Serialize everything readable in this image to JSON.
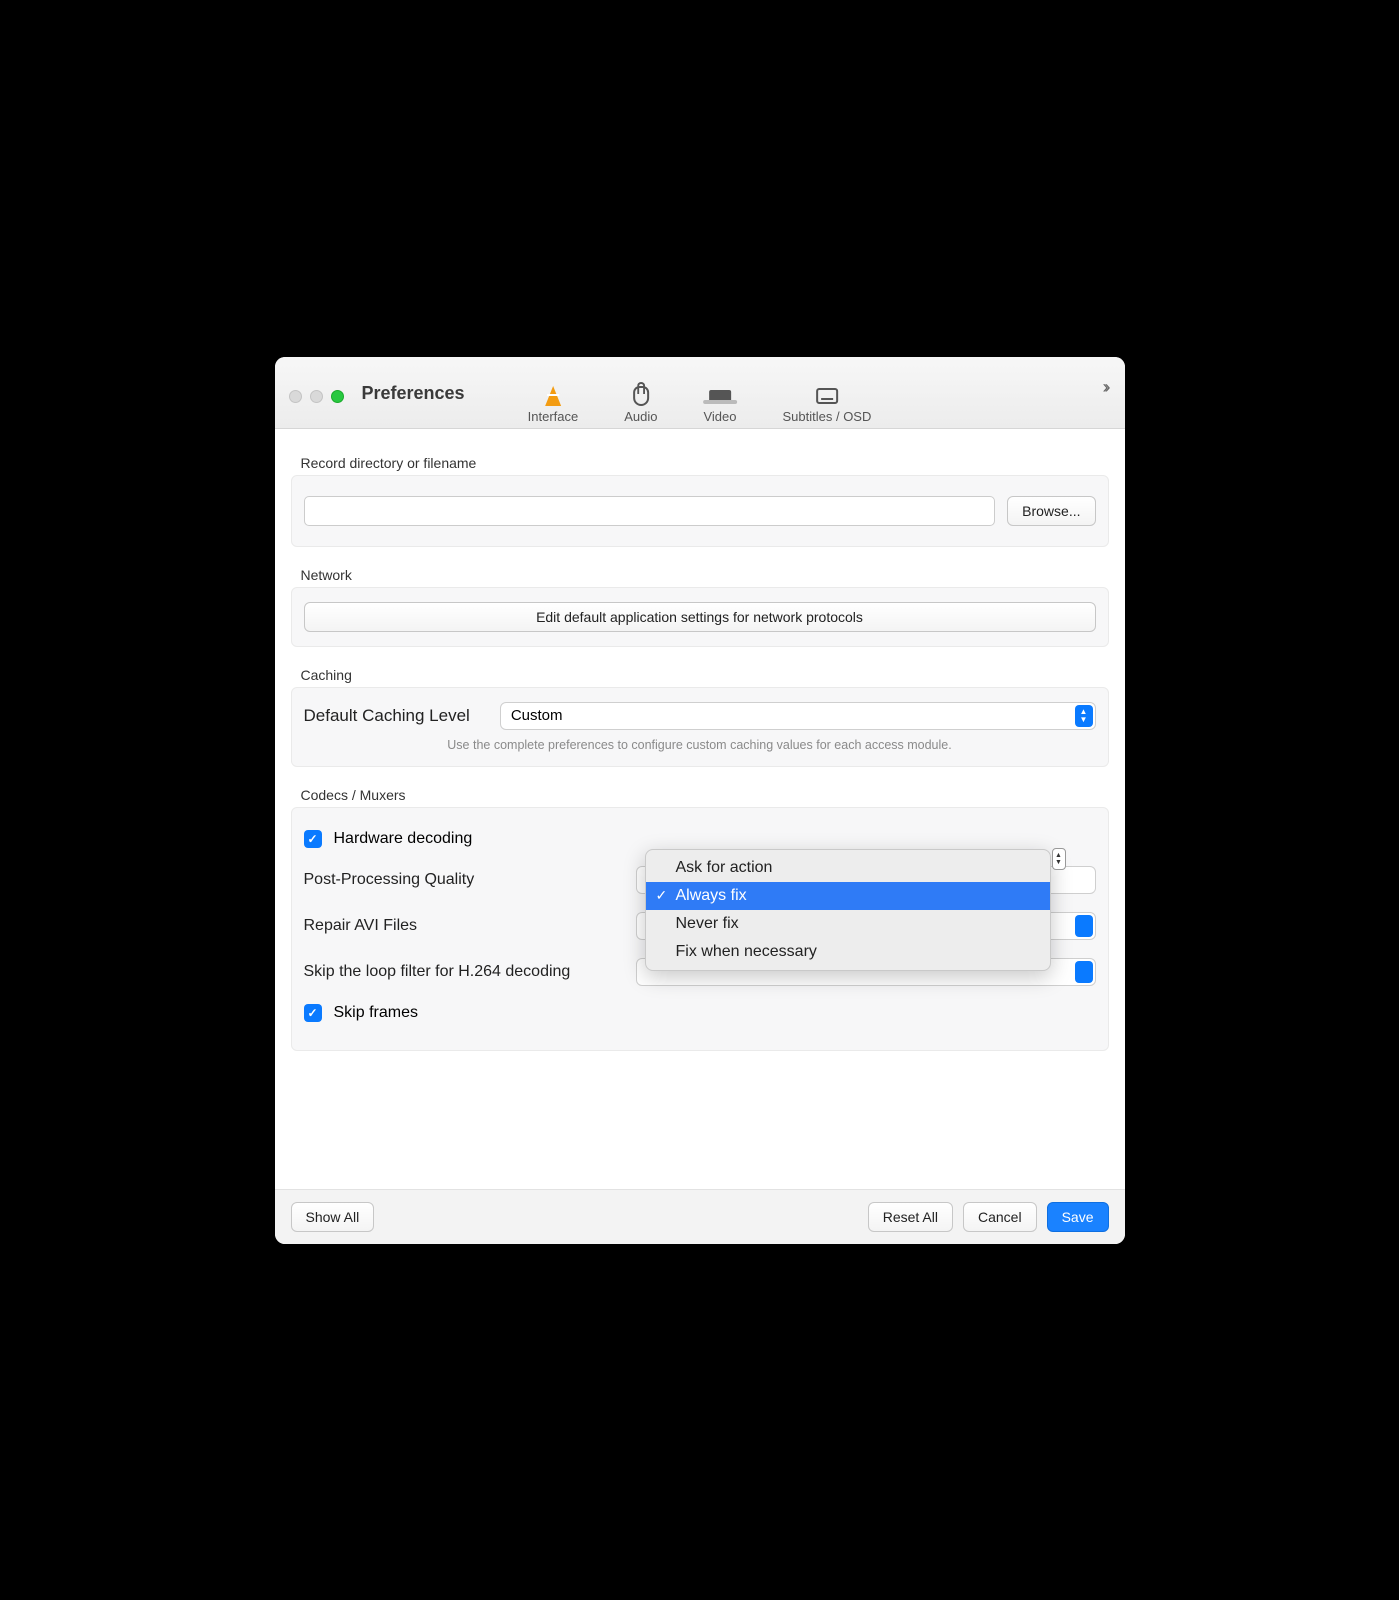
{
  "window": {
    "title": "Preferences"
  },
  "toolbar": {
    "items": [
      {
        "label": "Interface"
      },
      {
        "label": "Audio"
      },
      {
        "label": "Video"
      },
      {
        "label": "Subtitles / OSD"
      }
    ]
  },
  "record": {
    "section_label": "Record directory or filename",
    "path_value": "",
    "browse_label": "Browse..."
  },
  "network": {
    "section_label": "Network",
    "button_label": "Edit default application settings for network protocols"
  },
  "caching": {
    "section_label": "Caching",
    "level_label": "Default Caching Level",
    "level_value": "Custom",
    "hint": "Use the complete preferences to configure custom caching values for each access module."
  },
  "codecs": {
    "section_label": "Codecs / Muxers",
    "hardware_decoding_label": "Hardware decoding",
    "hardware_decoding_checked": true,
    "post_processing_label": "Post-Processing Quality",
    "repair_avi_label": "Repair AVI Files",
    "repair_avi_options": [
      "Ask for action",
      "Always fix",
      "Never fix",
      "Fix when necessary"
    ],
    "repair_avi_selected": "Always fix",
    "skip_loop_label": "Skip the loop filter for H.264 decoding",
    "skip_frames_label": "Skip frames",
    "skip_frames_checked": true
  },
  "footer": {
    "show_all_label": "Show All",
    "reset_label": "Reset All",
    "cancel_label": "Cancel",
    "save_label": "Save"
  }
}
